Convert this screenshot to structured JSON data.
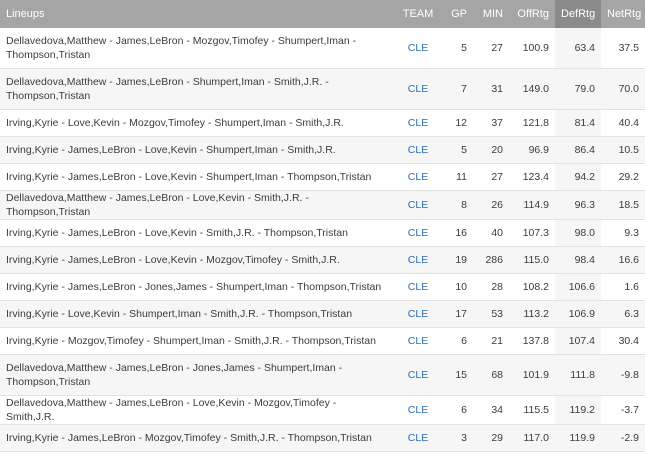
{
  "headers": {
    "lineup": "Lineups",
    "team": "TEAM",
    "gp": "GP",
    "min": "MIN",
    "offrtg": "OffRtg",
    "defrtg": "DefRtg",
    "netrtg": "NetRtg"
  },
  "sorted_column": "DefRtg",
  "rows": [
    {
      "lineup": "Dellavedova,Matthew - James,LeBron - Mozgov,Timofey - Shumpert,Iman - Thompson,Tristan",
      "team": "CLE",
      "gp": "5",
      "min": "27",
      "offrtg": "100.9",
      "defrtg": "63.4",
      "netrtg": "37.5"
    },
    {
      "lineup": "Dellavedova,Matthew - James,LeBron - Shumpert,Iman - Smith,J.R. - Thompson,Tristan",
      "team": "CLE",
      "gp": "7",
      "min": "31",
      "offrtg": "149.0",
      "defrtg": "79.0",
      "netrtg": "70.0"
    },
    {
      "lineup": "Irving,Kyrie - Love,Kevin - Mozgov,Timofey - Shumpert,Iman - Smith,J.R.",
      "team": "CLE",
      "gp": "12",
      "min": "37",
      "offrtg": "121.8",
      "defrtg": "81.4",
      "netrtg": "40.4"
    },
    {
      "lineup": "Irving,Kyrie - James,LeBron - Love,Kevin - Shumpert,Iman - Smith,J.R.",
      "team": "CLE",
      "gp": "5",
      "min": "20",
      "offrtg": "96.9",
      "defrtg": "86.4",
      "netrtg": "10.5"
    },
    {
      "lineup": "Irving,Kyrie - James,LeBron - Love,Kevin - Shumpert,Iman - Thompson,Tristan",
      "team": "CLE",
      "gp": "11",
      "min": "27",
      "offrtg": "123.4",
      "defrtg": "94.2",
      "netrtg": "29.2"
    },
    {
      "lineup": "Dellavedova,Matthew - James,LeBron - Love,Kevin - Smith,J.R. - Thompson,Tristan",
      "team": "CLE",
      "gp": "8",
      "min": "26",
      "offrtg": "114.9",
      "defrtg": "96.3",
      "netrtg": "18.5"
    },
    {
      "lineup": "Irving,Kyrie - James,LeBron - Love,Kevin - Smith,J.R. - Thompson,Tristan",
      "team": "CLE",
      "gp": "16",
      "min": "40",
      "offrtg": "107.3",
      "defrtg": "98.0",
      "netrtg": "9.3"
    },
    {
      "lineup": "Irving,Kyrie - James,LeBron - Love,Kevin - Mozgov,Timofey - Smith,J.R.",
      "team": "CLE",
      "gp": "19",
      "min": "286",
      "offrtg": "115.0",
      "defrtg": "98.4",
      "netrtg": "16.6"
    },
    {
      "lineup": "Irving,Kyrie - James,LeBron - Jones,James - Shumpert,Iman - Thompson,Tristan",
      "team": "CLE",
      "gp": "10",
      "min": "28",
      "offrtg": "108.2",
      "defrtg": "106.6",
      "netrtg": "1.6"
    },
    {
      "lineup": "Irving,Kyrie - Love,Kevin - Shumpert,Iman - Smith,J.R. - Thompson,Tristan",
      "team": "CLE",
      "gp": "17",
      "min": "53",
      "offrtg": "113.2",
      "defrtg": "106.9",
      "netrtg": "6.3"
    },
    {
      "lineup": "Irving,Kyrie - Mozgov,Timofey - Shumpert,Iman - Smith,J.R. - Thompson,Tristan",
      "team": "CLE",
      "gp": "6",
      "min": "21",
      "offrtg": "137.8",
      "defrtg": "107.4",
      "netrtg": "30.4"
    },
    {
      "lineup": "Dellavedova,Matthew - James,LeBron - Jones,James - Shumpert,Iman - Thompson,Tristan",
      "team": "CLE",
      "gp": "15",
      "min": "68",
      "offrtg": "101.9",
      "defrtg": "111.8",
      "netrtg": "-9.8"
    },
    {
      "lineup": "Dellavedova,Matthew - James,LeBron - Love,Kevin - Mozgov,Timofey - Smith,J.R.",
      "team": "CLE",
      "gp": "6",
      "min": "34",
      "offrtg": "115.5",
      "defrtg": "119.2",
      "netrtg": "-3.7"
    },
    {
      "lineup": "Irving,Kyrie - James,LeBron - Mozgov,Timofey - Smith,J.R. - Thompson,Tristan",
      "team": "CLE",
      "gp": "3",
      "min": "29",
      "offrtg": "117.0",
      "defrtg": "119.9",
      "netrtg": "-2.9"
    }
  ]
}
